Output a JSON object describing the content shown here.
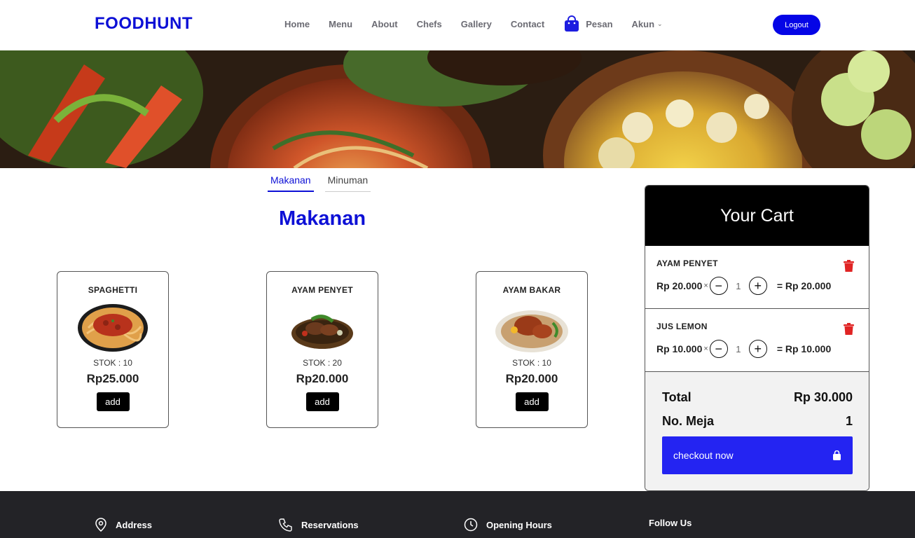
{
  "header": {
    "brand": "FOODHUNT",
    "nav": [
      "Home",
      "Menu",
      "About",
      "Chefs",
      "Gallery",
      "Contact"
    ],
    "pesan_label": "Pesan",
    "akun_label": "Akun",
    "logout_label": "Logout",
    "accent_color": "#0d10d6"
  },
  "tabs": [
    {
      "label": "Makanan",
      "active": true
    },
    {
      "label": "Minuman",
      "active": false
    }
  ],
  "section_title": "Makanan",
  "products": [
    {
      "name": "SPAGHETTI",
      "stok": "STOK : 10",
      "price": "Rp25.000",
      "add_label": "add",
      "icon": "spaghetti-image"
    },
    {
      "name": "AYAM PENYET",
      "stok": "STOK : 20",
      "price": "Rp20.000",
      "add_label": "add",
      "icon": "ayam-penyet-image"
    },
    {
      "name": "AYAM BAKAR",
      "stok": "STOK : 10",
      "price": "Rp20.000",
      "add_label": "add",
      "icon": "ayam-bakar-image"
    }
  ],
  "cart": {
    "title": "Your Cart",
    "items": [
      {
        "name": "AYAM PENYET",
        "unit_price": "Rp 20.000",
        "times": "×",
        "qty": "1",
        "subtotal": "= Rp 20.000"
      },
      {
        "name": "JUS LEMON",
        "unit_price": "Rp 10.000",
        "times": "×",
        "qty": "1",
        "subtotal": "= Rp 10.000"
      }
    ],
    "total_label": "Total",
    "total_value": "Rp 30.000",
    "meja_label": "No. Meja",
    "meja_value": "1",
    "checkout_label": "checkout now",
    "checkout_color": "#2424f2",
    "trash_color": "#e02424"
  },
  "footer": {
    "columns": [
      {
        "label": "Address",
        "icon": "map-pin-icon"
      },
      {
        "label": "Reservations",
        "icon": "phone-icon"
      },
      {
        "label": "Opening Hours",
        "icon": "clock-icon"
      },
      {
        "label": "Follow Us",
        "icon": ""
      }
    ]
  }
}
